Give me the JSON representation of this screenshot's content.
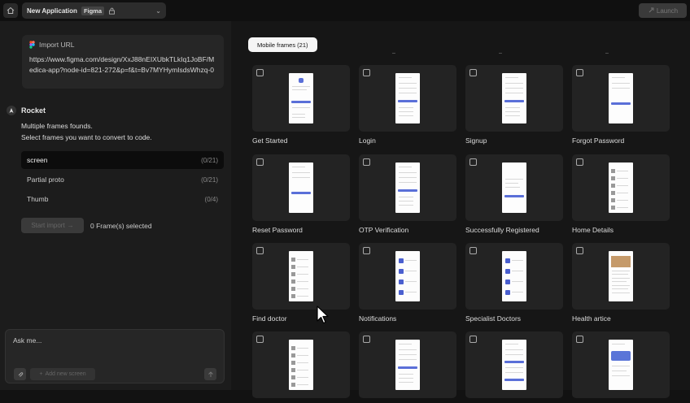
{
  "topbar": {
    "app_name": "New Application",
    "source_tag": "Figma",
    "launch_label": "Launch"
  },
  "import": {
    "title": "Import URL",
    "url": "https://www.figma.com/design/XxJ88nEIXUbkTLkIq1JoBF/Medica-app?node-id=821-272&p=f&t=Bv7MYHymIsdsWhzq-0"
  },
  "assistant": {
    "name": "Rocket",
    "message_line1": "Multiple frames founds.",
    "message_line2": "Select frames you want to convert to code."
  },
  "frame_groups": [
    {
      "label": "screen",
      "count": "(0/21)"
    },
    {
      "label": "Partial proto",
      "count": "(0/21)"
    },
    {
      "label": "Thumb",
      "count": "(0/4)"
    }
  ],
  "actions": {
    "start_import": "Start import",
    "selected_text": "0 Frame(s) selected"
  },
  "chat": {
    "placeholder": "Ask me...",
    "add_screen": "Add new screen"
  },
  "main": {
    "tab": "Mobile frames (21)",
    "frames": [
      {
        "label": "Get Started",
        "kind": "start"
      },
      {
        "label": "Login",
        "kind": "form"
      },
      {
        "label": "Signup",
        "kind": "form"
      },
      {
        "label": "Forgot Password",
        "kind": "simple"
      },
      {
        "label": "Reset Password",
        "kind": "simple"
      },
      {
        "label": "OTP Verification",
        "kind": "form"
      },
      {
        "label": "Successfully Registered",
        "kind": "success"
      },
      {
        "label": "Home Details",
        "kind": "list"
      },
      {
        "label": "Find doctor",
        "kind": "list"
      },
      {
        "label": "Notifications",
        "kind": "blue"
      },
      {
        "label": "Specialist Doctors",
        "kind": "blue"
      },
      {
        "label": "Health artice",
        "kind": "article"
      },
      {
        "label": "",
        "kind": "list"
      },
      {
        "label": "",
        "kind": "form"
      },
      {
        "label": "",
        "kind": "form2"
      },
      {
        "label": "",
        "kind": "banner"
      }
    ]
  }
}
